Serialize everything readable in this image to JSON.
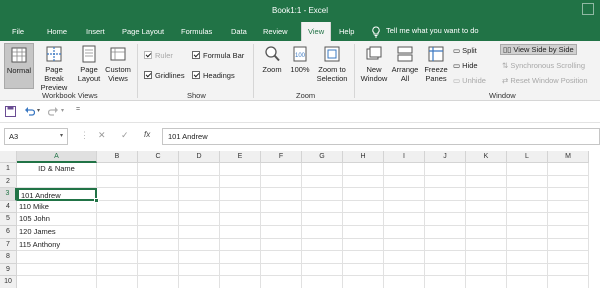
{
  "title": "Book1:1 - Excel",
  "tabs": [
    "File",
    "Home",
    "Insert",
    "Page Layout",
    "Formulas",
    "Data",
    "Review",
    "View",
    "Help"
  ],
  "active_tab": "View",
  "tell_me": "Tell me what you want to do",
  "ribbon": {
    "workbook_views": {
      "label": "Workbook Views",
      "normal": "Normal",
      "page_break": [
        "Page Break",
        "Preview"
      ],
      "page_layout": [
        "Page",
        "Layout"
      ],
      "custom_views": [
        "Custom",
        "Views"
      ]
    },
    "show": {
      "label": "Show",
      "ruler": "Ruler",
      "formula_bar": "Formula Bar",
      "gridlines": "Gridlines",
      "headings": "Headings"
    },
    "zoom": {
      "label": "Zoom",
      "zoom": "Zoom",
      "hundred": "100%",
      "zoom_selection": [
        "Zoom to",
        "Selection"
      ]
    },
    "window": {
      "label": "Window",
      "new_window": [
        "New",
        "Window"
      ],
      "arrange_all": [
        "Arrange",
        "All"
      ],
      "freeze_panes": [
        "Freeze",
        "Panes"
      ],
      "split": "Split",
      "hide": "Hide",
      "unhide": "Unhide",
      "view_side": "View Side by Side",
      "sync_scroll": "Synchronous Scrolling",
      "reset_window": "Reset Window Position"
    }
  },
  "formula_bar": {
    "name_box": "A3",
    "fx": "fx",
    "value": "101 Andrew"
  },
  "grid": {
    "columns": [
      "A",
      "B",
      "C",
      "D",
      "E",
      "F",
      "G",
      "H",
      "I",
      "J",
      "K",
      "L",
      "M"
    ],
    "rows": [
      "1",
      "2",
      "3",
      "4",
      "5",
      "6",
      "7",
      "8",
      "9",
      "10"
    ],
    "cells": {
      "A1": "ID & Name",
      "A3": "101 Andrew",
      "A4": "110 Mike",
      "A5": "105 John",
      "A6": "120 James",
      "A7": "115 Anthony"
    },
    "selected": "A3"
  },
  "colors": {
    "accent": "#217346"
  }
}
